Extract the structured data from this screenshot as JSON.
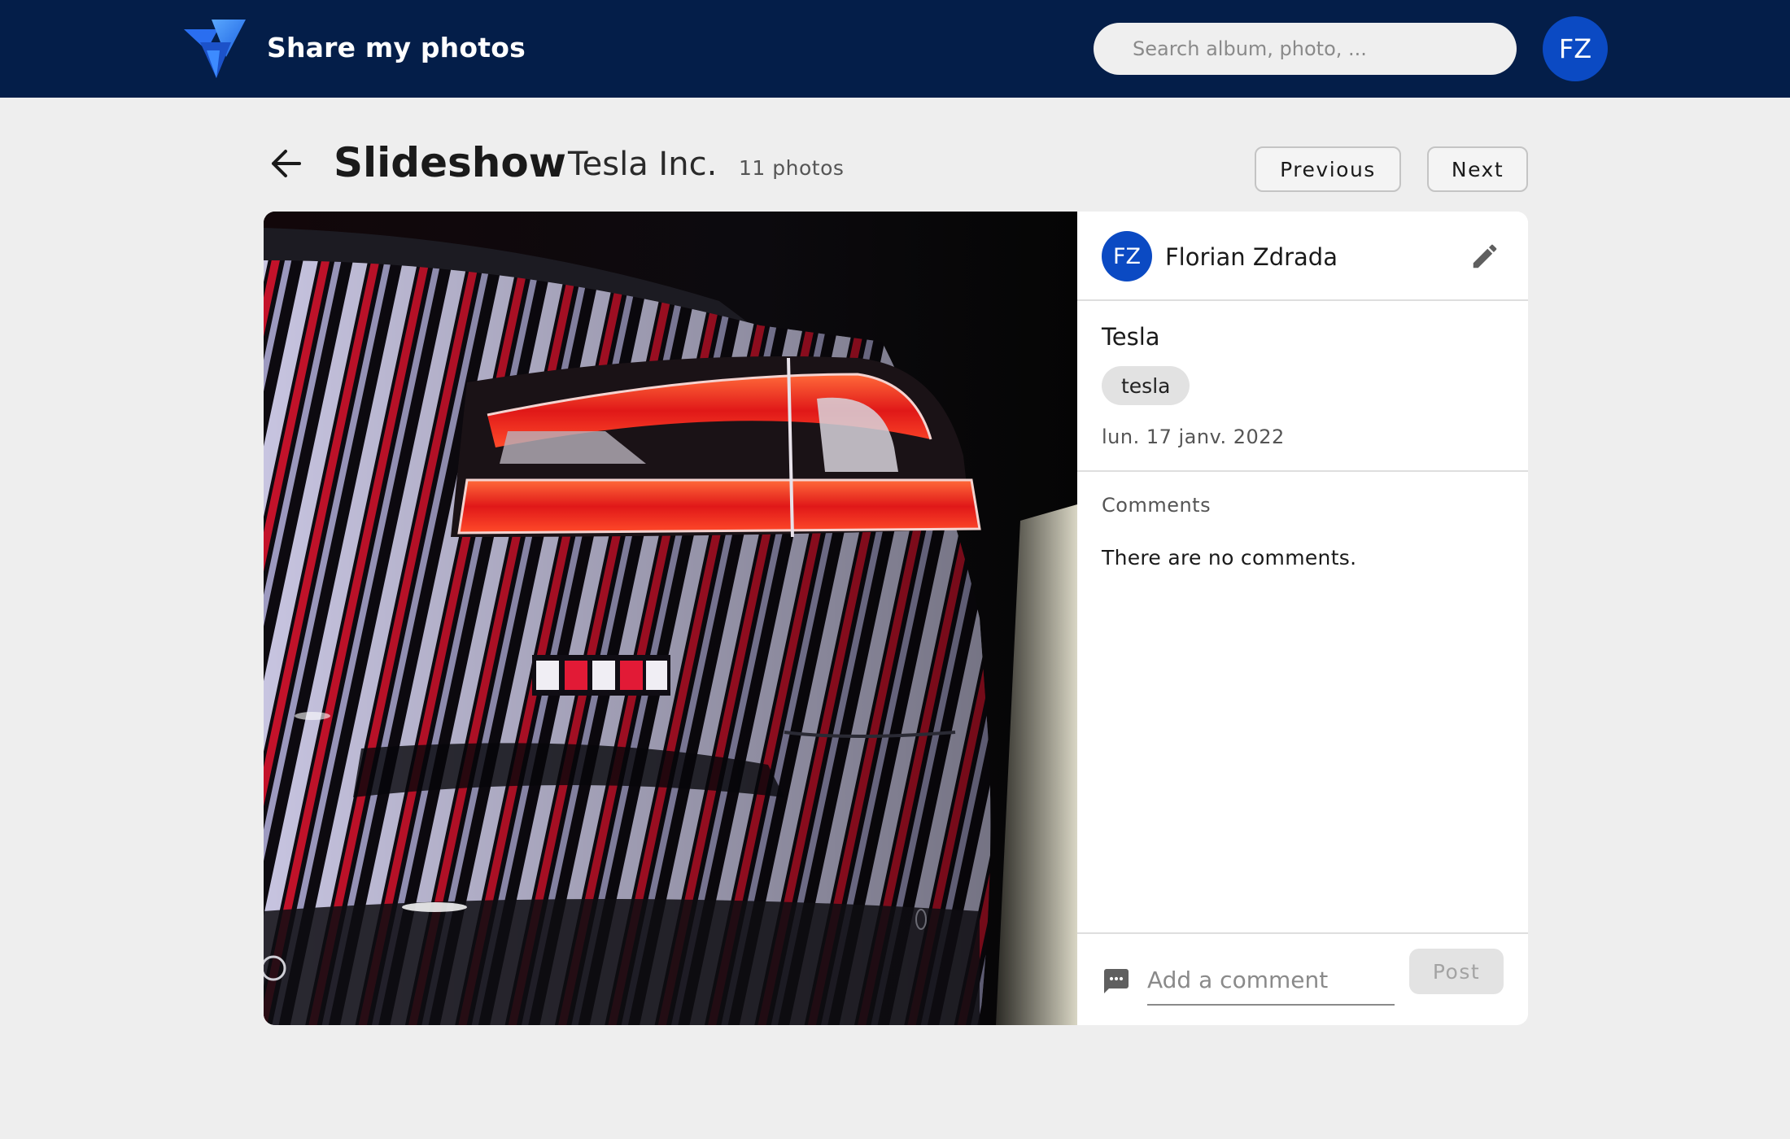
{
  "header": {
    "app_title": "Share my photos",
    "search_placeholder": "Search album, photo, ...",
    "user_initials": "FZ",
    "brand_color": "#041e49",
    "accent_color": "#0b4ac3"
  },
  "page": {
    "title": "Slideshow",
    "album_name": "Tesla Inc.",
    "photo_count": "11 photos",
    "previous_label": "Previous",
    "next_label": "Next"
  },
  "photo_details": {
    "owner_initials": "FZ",
    "owner_name": "Florian Zdrada",
    "photo_title": "Tesla",
    "tags": [
      "tesla"
    ],
    "date": "lun. 17 janv. 2022",
    "comments_heading": "Comments",
    "no_comments_text": "There are no comments.",
    "comment_placeholder": "Add a comment",
    "post_label": "Post"
  },
  "icons": {
    "logo": "logo-icon",
    "back": "arrow-left-icon",
    "edit": "pencil-icon",
    "comment": "comment-icon"
  }
}
